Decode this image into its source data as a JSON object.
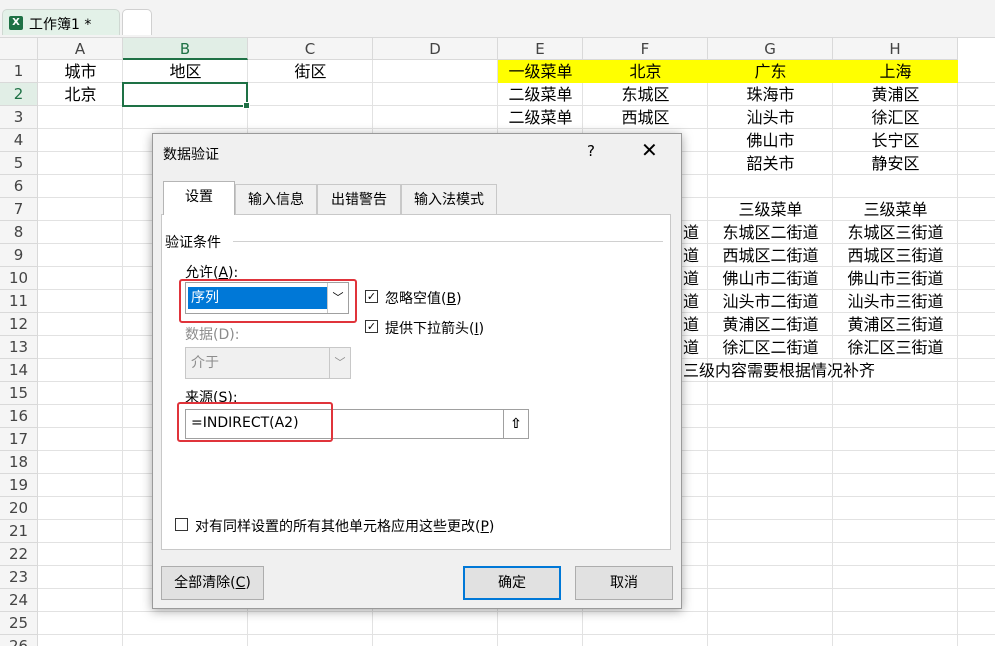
{
  "workbook": {
    "tab_name": "工作簿1 *"
  },
  "sheet": {
    "columns": [
      "A",
      "B",
      "C",
      "D",
      "E",
      "F",
      "G",
      "H"
    ],
    "rows": [
      "1",
      "2",
      "3",
      "4",
      "5",
      "6",
      "7",
      "8",
      "9",
      "10",
      "11",
      "12",
      "13",
      "14",
      "15",
      "16",
      "17",
      "18",
      "19",
      "20",
      "21",
      "22",
      "23",
      "24",
      "25",
      "26"
    ],
    "cells": {
      "A1": "城市",
      "B1": "地区",
      "C1": "街区",
      "A2": "北京",
      "E1": "一级菜单",
      "F1": "北京",
      "G1": "广东",
      "H1": "上海",
      "E2": "二级菜单",
      "F2": "东城区",
      "G2": "珠海市",
      "H2": "黄浦区",
      "E3": "二级菜单",
      "F3": "西城区",
      "G3": "汕头市",
      "H3": "徐汇区",
      "G4": "佛山市",
      "H4": "长宁区",
      "G5": "韶关市",
      "H5": "静安区",
      "G7": "三级菜单",
      "H7": "三级菜单",
      "F8": "道",
      "G8": "东城区二街道",
      "H8": "东城区三街道",
      "F9": "道",
      "G9": "西城区二街道",
      "H9": "西城区三街道",
      "F10": "道",
      "G10": "佛山市二街道",
      "H10": "佛山市三街道",
      "F11": "道",
      "G11": "汕头市二街道",
      "H11": "汕头市三街道",
      "F12": "道",
      "G12": "黄浦区二街道",
      "H12": "黄浦区三街道",
      "F13": "道",
      "G13": "徐汇区二街道",
      "H13": "徐汇区三街道",
      "F14": "三级内容需要根据情况补齐"
    }
  },
  "dialog": {
    "title": "数据验证",
    "help": "?",
    "close": "✕",
    "tabs": [
      "设置",
      "输入信息",
      "出错警告",
      "输入法模式"
    ],
    "group_label": "验证条件",
    "allow_label": "允许(",
    "allow_key": "A",
    "allow_label_end": "):",
    "allow_value": "序列",
    "data_label": "数据(D):",
    "data_value": "介于",
    "ignore_blank": "忽略空值(",
    "ignore_blank_key": "B",
    "ignore_blank_end": ")",
    "dropdown": "提供下拉箭头(",
    "dropdown_key": "I",
    "dropdown_end": ")",
    "source_label": "来源(",
    "source_key": "S",
    "source_label_end": "):",
    "source_value": "=INDIRECT(A2)",
    "apply_all": "对有同样设置的所有其他单元格应用这些更改(",
    "apply_all_key": "P",
    "apply_all_end": ")",
    "clear_all": "全部清除(",
    "clear_all_key": "C",
    "clear_all_end": ")",
    "ok": "确定",
    "cancel": "取消",
    "ignore_blank_checked": true,
    "dropdown_checked": true,
    "apply_all_checked": false
  }
}
